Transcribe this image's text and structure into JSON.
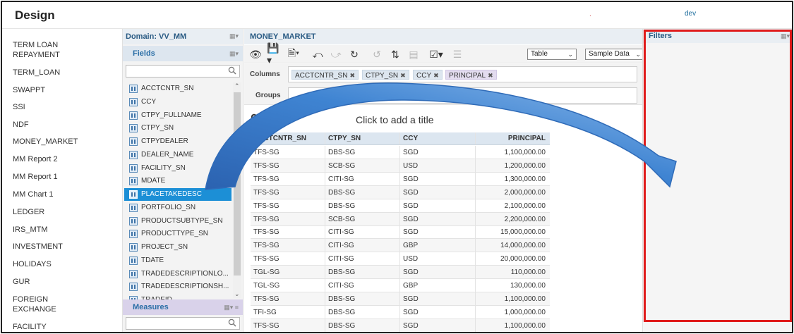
{
  "header": {
    "title": "Design",
    "dot": ".",
    "env": "dev"
  },
  "leftnav": {
    "items": [
      "TERM LOAN\nREPAYMENT",
      "TERM_LOAN",
      "SWAPPT",
      "SSI",
      "NDF",
      "MONEY_MARKET",
      "MM Report 2",
      "MM Report 1",
      "MM Chart 1",
      "LEDGER",
      "IRS_MTM",
      "INVESTMENT",
      "HOLIDAYS",
      "GUR",
      "FOREIGN\nEXCHANGE",
      "FACILITY"
    ]
  },
  "domain": {
    "label": "Domain: VV_MM"
  },
  "fields": {
    "label": "Fields",
    "items": [
      "ACCTCNTR_SN",
      "CCY",
      "CTPY_FULLNAME",
      "CTPY_SN",
      "CTPYDEALER",
      "DEALER_NAME",
      "FACILITY_SN",
      "MDATE",
      "PLACETAKEDESC",
      "PORTFOLIO_SN",
      "PRODUCTSUBTYPE_SN",
      "PRODUCTTYPE_SN",
      "PROJECT_SN",
      "TDATE",
      "TRADEDESCRIPTIONLO...",
      "TRADEDESCRIPTIONSH...",
      "TRADEID"
    ],
    "selected": "PLACETAKEDESC"
  },
  "measures": {
    "label": "Measures"
  },
  "report": {
    "name": "MONEY_MARKET",
    "view_select": "Table",
    "data_select": "Sample Data",
    "columns_label": "Columns",
    "groups_label": "Groups",
    "columns": [
      {
        "label": "ACCTCNTR_SN",
        "kind": "dimension"
      },
      {
        "label": "CTPY_SN",
        "kind": "dimension"
      },
      {
        "label": "CCY",
        "kind": "dimension"
      },
      {
        "label": "PRINCIPAL",
        "kind": "measure"
      }
    ],
    "title_placeholder": "Click to add a title",
    "table": {
      "headers": [
        "ACCTCNTR_SN",
        "CTPY_SN",
        "CCY",
        "PRINCIPAL"
      ],
      "rows": [
        [
          "TFS-SG",
          "DBS-SG",
          "SGD",
          "1,100,000.00"
        ],
        [
          "TFS-SG",
          "SCB-SG",
          "USD",
          "1,200,000.00"
        ],
        [
          "TFS-SG",
          "CITI-SG",
          "SGD",
          "1,300,000.00"
        ],
        [
          "TFS-SG",
          "DBS-SG",
          "SGD",
          "2,000,000.00"
        ],
        [
          "TFS-SG",
          "DBS-SG",
          "SGD",
          "2,100,000.00"
        ],
        [
          "TFS-SG",
          "SCB-SG",
          "SGD",
          "2,200,000.00"
        ],
        [
          "TFS-SG",
          "CITI-SG",
          "SGD",
          "15,000,000.00"
        ],
        [
          "TFS-SG",
          "CITI-SG",
          "GBP",
          "14,000,000.00"
        ],
        [
          "TFS-SG",
          "CITI-SG",
          "USD",
          "20,000,000.00"
        ],
        [
          "TGL-SG",
          "DBS-SG",
          "SGD",
          "110,000.00"
        ],
        [
          "TGL-SG",
          "CITI-SG",
          "GBP",
          "130,000.00"
        ],
        [
          "TFS-SG",
          "DBS-SG",
          "SGD",
          "1,100,000.00"
        ],
        [
          "TFI-SG",
          "DBS-SG",
          "SGD",
          "1,000,000.00"
        ],
        [
          "TFS-SG",
          "DBS-SG",
          "SGD",
          "1,100,000.00"
        ]
      ]
    }
  },
  "filters": {
    "label": "Filters"
  },
  "colors": {
    "highlight_red": "#e01b1b",
    "selected_blue": "#1c8fd6",
    "arrow_blue": "#3d7cc9"
  }
}
